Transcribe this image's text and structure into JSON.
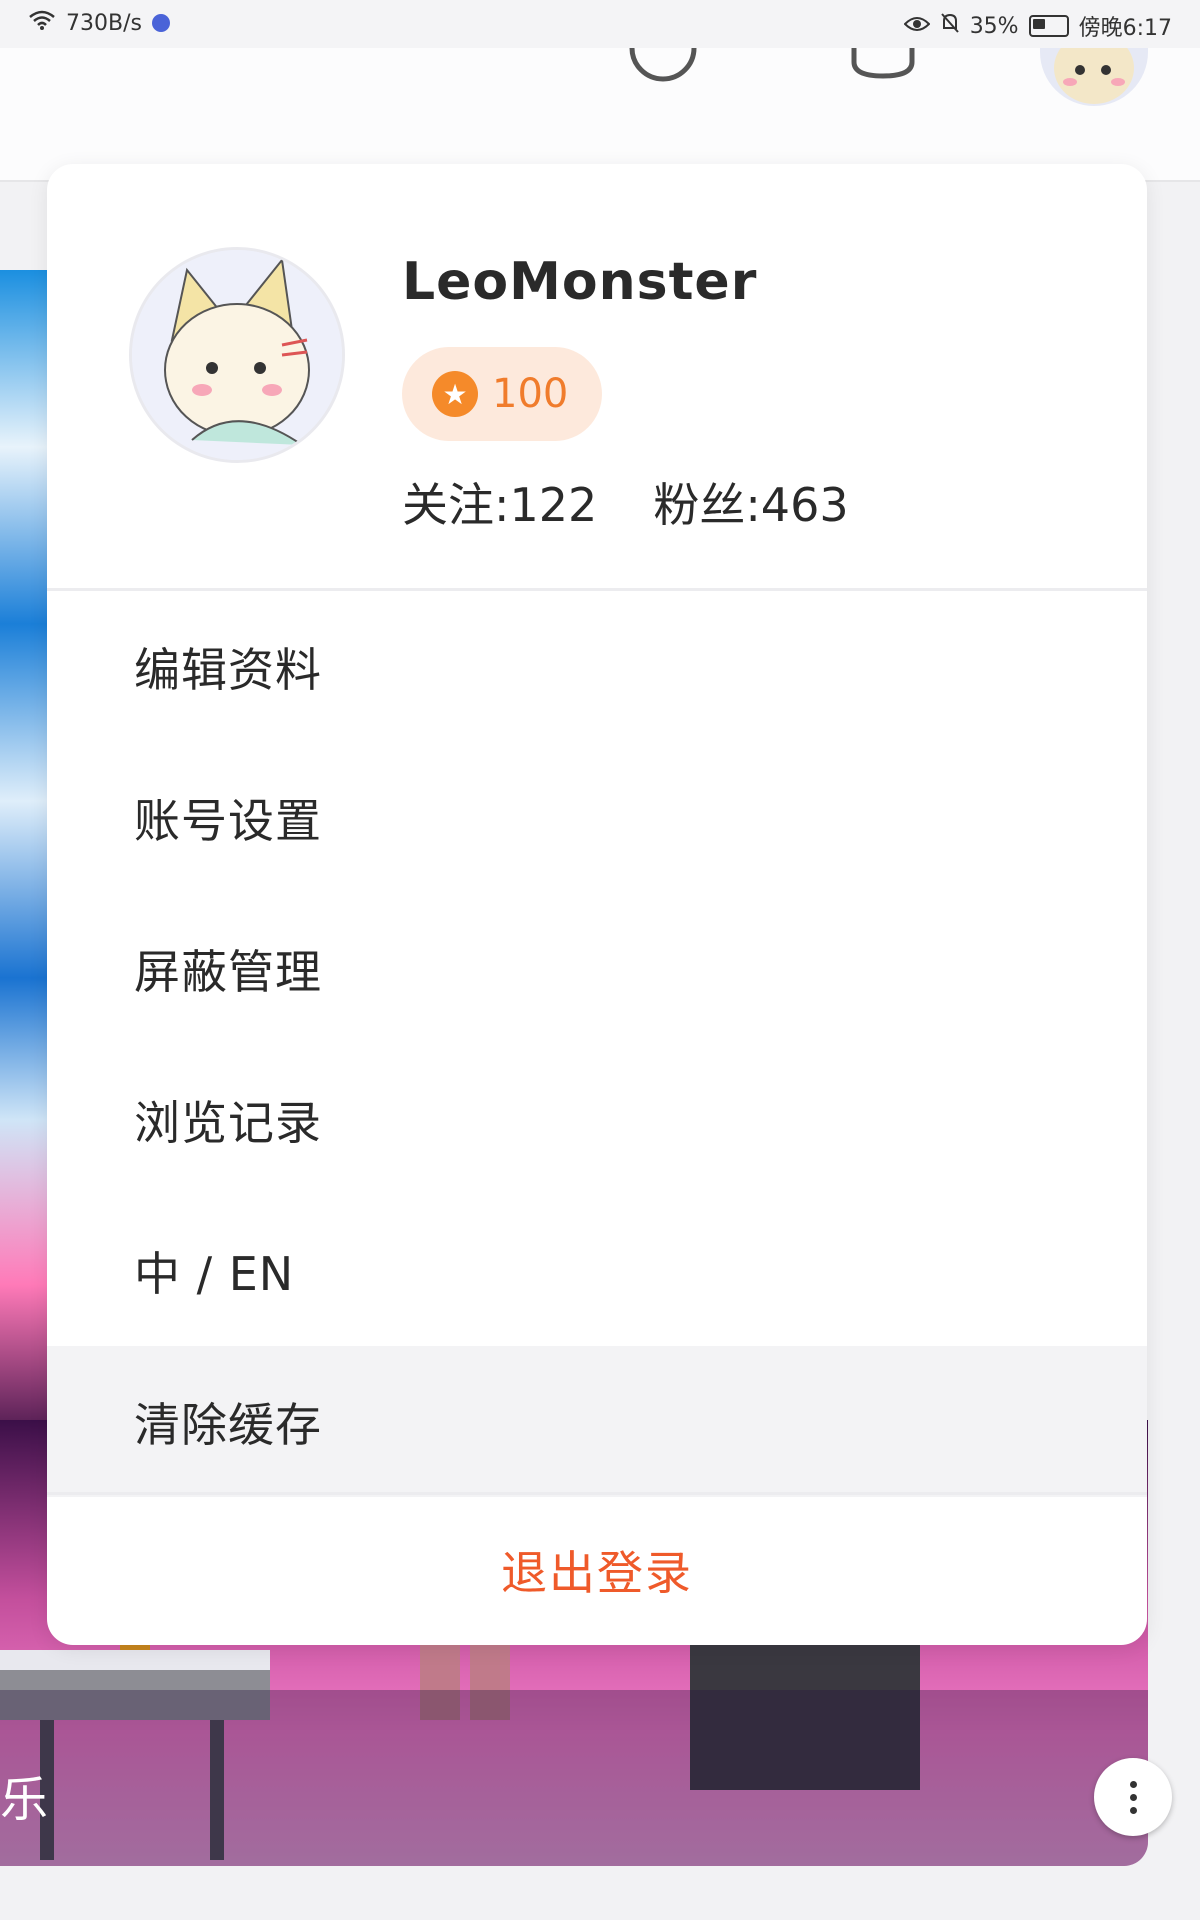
{
  "status_bar": {
    "network_speed": "730B/s",
    "battery": "35%",
    "time": "傍晚6:17"
  },
  "profile": {
    "username": "LeoMonster",
    "points": "100",
    "following": "关注:122",
    "followers": "粉丝:463"
  },
  "menu": {
    "items": [
      {
        "label": "编辑资料"
      },
      {
        "label": "账号设置"
      },
      {
        "label": "屏蔽管理"
      },
      {
        "label": "浏览记录"
      },
      {
        "label": "中 / EN"
      },
      {
        "label": "清除缓存"
      }
    ],
    "logout_label": "退出登录"
  },
  "background": {
    "banner_text": "乐"
  },
  "colors": {
    "accent": "#ef5a2a",
    "points_bg": "#fde9dc",
    "points_text": "#f07c2c"
  }
}
